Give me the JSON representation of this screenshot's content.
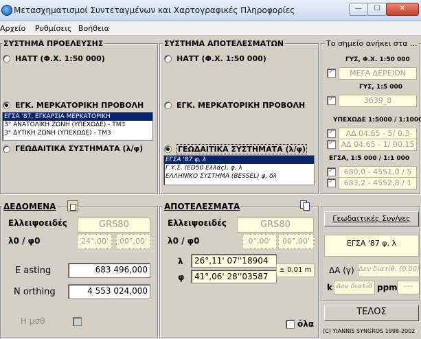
{
  "window": {
    "title": "Μετασχηματισμοί Συντεταγμένων και Χαρτογραφικές Πληροφορίες",
    "min": "—",
    "max": "☐",
    "close": "✕"
  },
  "menu": [
    "Αρχείο",
    "Ρυθμίσεις",
    "Βοήθεια"
  ],
  "source": {
    "title": "ΣΥΣΤΗΜΑ ΠΡΟΕΛΕΥΣΗΣ",
    "opt1": "ΗΑΤΤ (Φ.Χ. 1:50 000)",
    "opt2": "ΕΓΚ. ΜΕΡΚΑΤΟΡΙΚΗ ΠΡΟΒΟΛΗ",
    "opt3": "ΓΕΩΔΑΙΤΙΚΑ ΣΥΣΤΗΜΑΤΑ (λ/φ)",
    "list": [
      "ΕΓΣΑ '87, ΕΓΚΑΡΣΙΑ ΜΕΡΚΑΤΟΡΙΚΗ",
      "3° ΑΝΑΤΟΛΙΚΗ ΖΩΝΗ (ΥΠΕΧΩΔΕ) - ΤΜ3",
      "3° ΔΥΤΙΚΗ ΖΩΝΗ (ΥΠΕΧΩΔΕ) - ΤΜ3"
    ]
  },
  "result": {
    "title": "ΣΥΣΤΗΜΑ ΑΠΟΤΕΛΕΣΜΑΤΩΝ",
    "opt1": "ΗΑΤΤ (Φ.Χ. 1:50 000)",
    "opt2": "ΕΓΚ. ΜΕΡΚΑΤΟΡΙΚΗ ΠΡΟΒΟΛΗ",
    "opt3": "ΓΕΩΔΑΙΤΙΚΑ ΣΥΣΤΗΜΑΤΑ (λ/φ)",
    "list": [
      "ΕΓΣΑ '87 φ, λ",
      "Γ.Υ.Σ. (ED50 Ελλάς), φ, λ",
      "ΕΛΛΗΝΙΚΟ ΣΥΣΤΗΜΑ (BESSEL) φ, δλ"
    ]
  },
  "point": {
    "title": "Το σημείο ανήκει στα ...",
    "g1": "ΓΥΣ, Φ.Χ. 1:50 000",
    "v1": "ΜΕΓΑ ΔΕΡΕΙΟΝ",
    "g2": "ΓΥΣ,  1:5 000",
    "v2": "3639_8",
    "g3": "ΥΠΕΧΩΔΕ 1:5000 / 1:1000",
    "v3a": "ΑΔ 04.65 - 5/ 0.3",
    "v3b": "ΑΔ 04.65 - 1/ 00.15",
    "g4": "ΕΓΣΑ, 1:5 000 / 1:1 000",
    "v4a": "680,0 - 4551,0 / 5",
    "v4b": "683,2 - 4552,8 / 1"
  },
  "data": {
    "title": "ΔΕΔΟΜΕΝΑ",
    "ellipsoid_label": "Ελλειψοειδές",
    "ellipsoid": "GRS80",
    "lf_label": "λ0 / φ0",
    "l0": "24°,00'",
    "f0": "00°,00'",
    "easting_label": "E asting",
    "easting": "683 496,000",
    "northing_label": "N orthing",
    "northing": "4 553 024,000",
    "hmsth_label": "H μσθ"
  },
  "results": {
    "title": "ΑΠΟΤΕΛΕΣΜΑΤΑ",
    "ellipsoid_label": "Ελλειψοειδές",
    "ellipsoid": "GRS80",
    "lf_label": "λ0 / φ0",
    "l0": "0°,00'",
    "f0": "00°,00'",
    "lambda_label": "λ",
    "lambda": "26°,11' 07''18904",
    "phi_label": "φ",
    "phi": "41°,06' 28''03587",
    "accuracy": "± 0,01 m",
    "all_label": "όλα"
  },
  "right": {
    "geod_button": "Γεωδαιτικές Συν/νες",
    "geod_value": "ΕΓΣΑ '87 φ, λ",
    "dg_label": "ΔΑ (γ)",
    "dg_value": "Δεν διατίθ. (0.00)",
    "k_label": "k",
    "k_value": "Δεν διατίθ",
    "ppm_label": "ppm",
    "ppm_value": "----",
    "end_button": "ΤΕΛΟΣ",
    "copyright": "(C) YIANNIS SYNGROS 1998-2002"
  }
}
